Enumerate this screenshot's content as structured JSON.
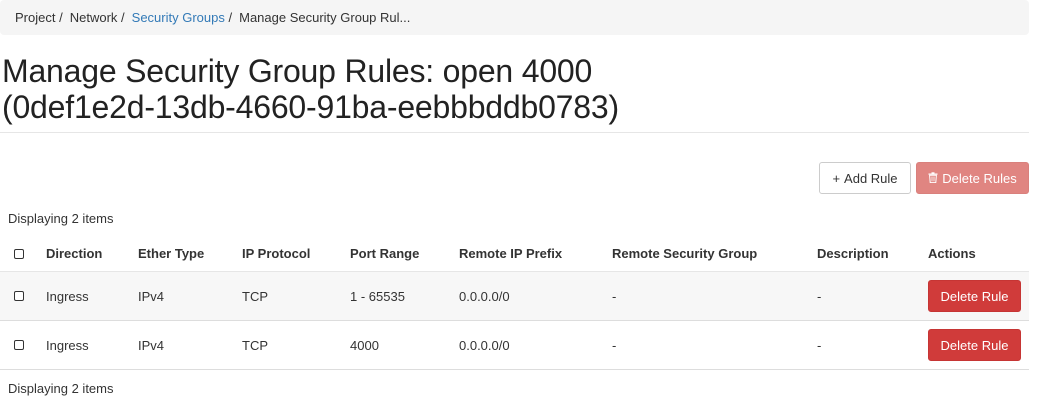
{
  "breadcrumb": {
    "items": [
      {
        "label": "Project",
        "link": false
      },
      {
        "label": "Network",
        "link": false
      },
      {
        "label": "Security Groups",
        "link": true
      },
      {
        "label": "Manage Security Group Rul...",
        "link": false
      }
    ],
    "separator": "/"
  },
  "page": {
    "title_line1": "Manage Security Group Rules: open 4000",
    "title_line2": "(0def1e2d-13db-4660-91ba-eebbbddb0783)"
  },
  "toolbar": {
    "add_rule_label": "Add Rule",
    "add_rule_icon": "+",
    "delete_rules_label": "Delete Rules",
    "delete_rules_icon": "🗑"
  },
  "table": {
    "count_top": "Displaying 2 items",
    "count_bottom": "Displaying 2 items",
    "headers": {
      "direction": "Direction",
      "ether_type": "Ether Type",
      "ip_protocol": "IP Protocol",
      "port_range": "Port Range",
      "remote_ip_prefix": "Remote IP Prefix",
      "remote_security_group": "Remote Security Group",
      "description": "Description",
      "actions": "Actions"
    },
    "rows": [
      {
        "direction": "Ingress",
        "ether_type": "IPv4",
        "ip_protocol": "TCP",
        "port_range": "1 - 65535",
        "remote_ip_prefix": "0.0.0.0/0",
        "remote_security_group": "-",
        "description": "-",
        "action_label": "Delete Rule"
      },
      {
        "direction": "Ingress",
        "ether_type": "IPv4",
        "ip_protocol": "TCP",
        "port_range": "4000",
        "remote_ip_prefix": "0.0.0.0/0",
        "remote_security_group": "-",
        "description": "-",
        "action_label": "Delete Rule"
      }
    ]
  },
  "colors": {
    "link": "#337ab7",
    "danger": "#d03b3a",
    "danger_disabled": "#e08581",
    "breadcrumb_bg": "#f5f5f5",
    "row_striped_bg": "#f7f7f7"
  }
}
